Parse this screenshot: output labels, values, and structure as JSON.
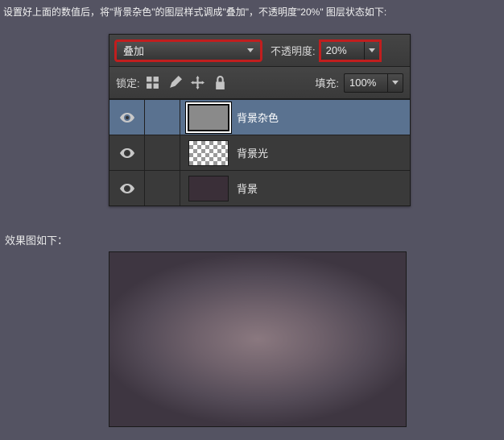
{
  "instruction": "设置好上面的数值后，将\"背景杂色\"的图层样式调成\"叠加\"，不透明度\"20%\" 图层状态如下:",
  "panel": {
    "blend_mode": "叠加",
    "opacity_label": "不透明度:",
    "opacity_value": "20%",
    "lock_label": "锁定:",
    "fill_label": "填充:",
    "fill_value": "100%",
    "icons": [
      "transparency-lock-icon",
      "brush-lock-icon",
      "move-lock-icon",
      "full-lock-icon"
    ],
    "layers": [
      {
        "name": "背景杂色",
        "selected": true,
        "thumb": "noise"
      },
      {
        "name": "背景光",
        "selected": false,
        "thumb": "checker"
      },
      {
        "name": "背景",
        "selected": false,
        "thumb": "bg"
      }
    ]
  },
  "result_label": "效果图如下："
}
